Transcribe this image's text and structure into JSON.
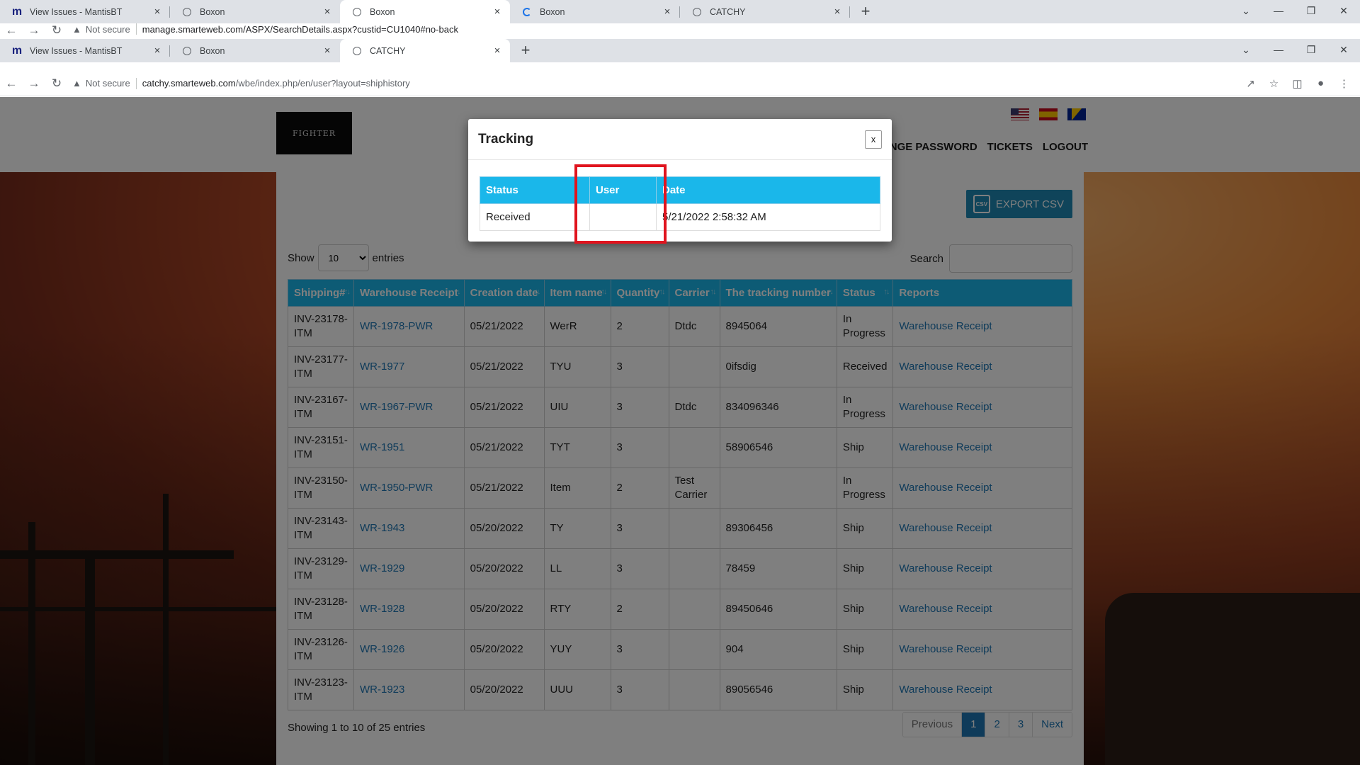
{
  "back_window": {
    "tabs": [
      {
        "title": "View Issues - MantisBT",
        "icon": "mantis-icon"
      },
      {
        "title": "Boxon",
        "icon": "globe-icon"
      },
      {
        "title": "Boxon",
        "icon": "globe-icon"
      },
      {
        "title": "Boxon",
        "icon": "loading-icon"
      },
      {
        "title": "CATCHY",
        "icon": "globe-icon"
      }
    ],
    "url": "manage.smarteweb.com/ASPX/SearchDetails.aspx?custid=CU1040#no-back"
  },
  "browser": {
    "tabs": [
      {
        "title": "View Issues - MantisBT",
        "icon": "mantis-icon"
      },
      {
        "title": "Boxon",
        "icon": "globe-icon"
      },
      {
        "title": "CATCHY",
        "icon": "globe-icon"
      }
    ],
    "not_secure": "Not secure",
    "url_host": "catchy.smarteweb.com",
    "url_path": "/wbe/index.php/en/user?layout=shiphistory"
  },
  "header": {
    "logo_text": "FIGHTER",
    "nav": [
      "HANGE PASSWORD",
      "TICKETS",
      "LOGOUT"
    ],
    "flags": [
      "us-flag",
      "spain-flag",
      "bosnia-flag"
    ]
  },
  "toolbar": {
    "export_label": "EXPORT CSV",
    "csv_icon_label": "CSV"
  },
  "list_controls": {
    "show_label": "Show",
    "entries_value": "10",
    "entries_label": "entries",
    "search_label": "Search",
    "search_value": ""
  },
  "table": {
    "columns": [
      "Shipping#",
      "Warehouse Receipt",
      "Creation date",
      "Item name",
      "Quantity",
      "Carrier",
      "The tracking number",
      "Status",
      "Reports"
    ],
    "rows": [
      {
        "shipping": "INV-23178-ITM",
        "receipt": "WR-1978-PWR",
        "date": "05/21/2022",
        "item": "WerR",
        "qty": "2",
        "carrier": "Dtdc",
        "tracking": "8945064",
        "status": "In Progress",
        "report": "Warehouse Receipt"
      },
      {
        "shipping": "INV-23177-ITM",
        "receipt": "WR-1977",
        "date": "05/21/2022",
        "item": "TYU",
        "qty": "3",
        "carrier": "",
        "tracking": "0ifsdig",
        "status": "Received",
        "report": "Warehouse Receipt"
      },
      {
        "shipping": "INV-23167-ITM",
        "receipt": "WR-1967-PWR",
        "date": "05/21/2022",
        "item": "UIU",
        "qty": "3",
        "carrier": "Dtdc",
        "tracking": "834096346",
        "status": "In Progress",
        "report": "Warehouse Receipt"
      },
      {
        "shipping": "INV-23151-ITM",
        "receipt": "WR-1951",
        "date": "05/21/2022",
        "item": "TYT",
        "qty": "3",
        "carrier": "",
        "tracking": "58906546",
        "status": "Ship",
        "report": "Warehouse Receipt"
      },
      {
        "shipping": "INV-23150-ITM",
        "receipt": "WR-1950-PWR",
        "date": "05/21/2022",
        "item": "Item",
        "qty": "2",
        "carrier": "Test Carrier",
        "tracking": "",
        "status": "In Progress",
        "report": "Warehouse Receipt"
      },
      {
        "shipping": "INV-23143-ITM",
        "receipt": "WR-1943",
        "date": "05/20/2022",
        "item": "TY",
        "qty": "3",
        "carrier": "",
        "tracking": "89306456",
        "status": "Ship",
        "report": "Warehouse Receipt"
      },
      {
        "shipping": "INV-23129-ITM",
        "receipt": "WR-1929",
        "date": "05/20/2022",
        "item": "LL",
        "qty": "3",
        "carrier": "",
        "tracking": "78459",
        "status": "Ship",
        "report": "Warehouse Receipt"
      },
      {
        "shipping": "INV-23128-ITM",
        "receipt": "WR-1928",
        "date": "05/20/2022",
        "item": "RTY",
        "qty": "2",
        "carrier": "",
        "tracking": "89450646",
        "status": "Ship",
        "report": "Warehouse Receipt"
      },
      {
        "shipping": "INV-23126-ITM",
        "receipt": "WR-1926",
        "date": "05/20/2022",
        "item": "YUY",
        "qty": "3",
        "carrier": "",
        "tracking": "904",
        "status": "Ship",
        "report": "Warehouse Receipt"
      },
      {
        "shipping": "INV-23123-ITM",
        "receipt": "WR-1923",
        "date": "05/20/2022",
        "item": "UUU",
        "qty": "3",
        "carrier": "",
        "tracking": "89056546",
        "status": "Ship",
        "report": "Warehouse Receipt"
      }
    ]
  },
  "footer": {
    "info": "Showing 1 to 10 of 25 entries",
    "pagination": {
      "previous": "Previous",
      "pages": [
        "1",
        "2",
        "3"
      ],
      "next": "Next",
      "current": "1"
    }
  },
  "modal": {
    "title": "Tracking",
    "close_label": "x",
    "columns": [
      "Status",
      "User",
      "Date"
    ],
    "rows": [
      {
        "status": "Received",
        "user": "",
        "date": "5/21/2022 2:58:32 AM"
      }
    ]
  },
  "colors": {
    "table_header": "#1ab7ea",
    "link": "#1f77b4",
    "highlight": "#e0141e"
  }
}
